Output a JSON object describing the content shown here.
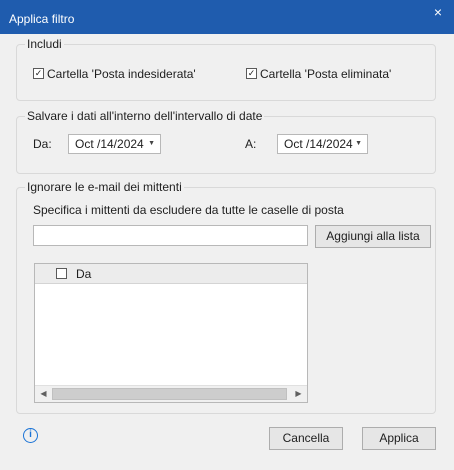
{
  "window": {
    "title": "Applica filtro",
    "close_icon": "×"
  },
  "include_group": {
    "legend": "Includi",
    "junk_checkbox": {
      "label": "Cartella 'Posta indesiderata'",
      "checked": true
    },
    "deleted_checkbox": {
      "label": "Cartella 'Posta eliminata'",
      "checked": true
    }
  },
  "date_group": {
    "legend": "Salvare i dati all'interno dell'intervallo di date",
    "from_label": "Da:",
    "from_value": "Oct /14/2024",
    "to_label": "A:",
    "to_value": "Oct /14/2024"
  },
  "ignore_group": {
    "legend": "Ignorare le e-mail dei mittenti",
    "instruction": "Specifica i mittenti da escludere da tutte le caselle di posta",
    "sender_input_value": "",
    "add_button": "Aggiungi alla lista",
    "list_header": "Da",
    "list_items": []
  },
  "footer": {
    "info_icon": "i",
    "cancel_button": "Cancella",
    "apply_button": "Applica"
  },
  "colors": {
    "titlebar": "#1f5cae",
    "background": "#f0f0f0",
    "info_accent": "#1a73d6"
  }
}
